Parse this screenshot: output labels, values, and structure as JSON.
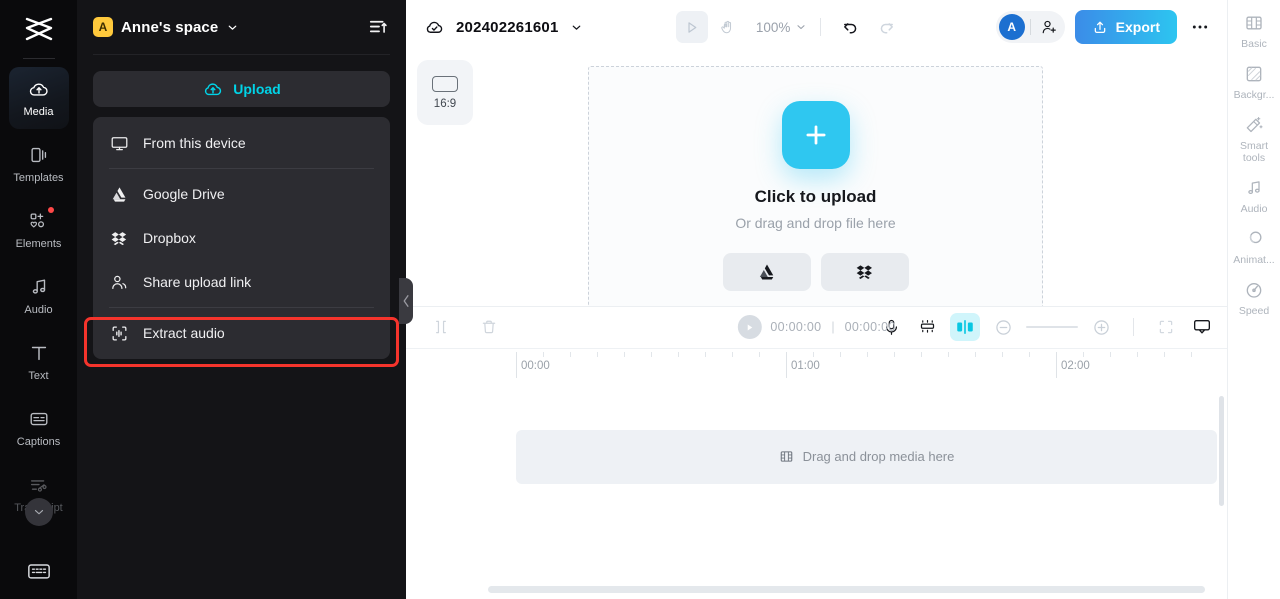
{
  "left_rail": {
    "logo_name": "capcut-logo",
    "items": [
      {
        "label": "Media",
        "icon": "cloud-upload-icon",
        "active": true,
        "dim": false,
        "badge": false
      },
      {
        "label": "Templates",
        "icon": "templates-icon",
        "active": false,
        "dim": false,
        "badge": false
      },
      {
        "label": "Elements",
        "icon": "elements-icon",
        "active": false,
        "dim": false,
        "badge": true
      },
      {
        "label": "Audio",
        "icon": "music-note-icon",
        "active": false,
        "dim": false,
        "badge": false
      },
      {
        "label": "Text",
        "icon": "text-t-icon",
        "active": false,
        "dim": false,
        "badge": false
      },
      {
        "label": "Captions",
        "icon": "captions-icon",
        "active": false,
        "dim": false,
        "badge": false
      },
      {
        "label": "Transcript",
        "icon": "transcript-icon",
        "active": false,
        "dim": true,
        "badge": false
      }
    ],
    "collapse_icon": "chevron-down-icon",
    "bottom_icon": "keyboard-shortcuts-icon"
  },
  "panel": {
    "space_initial": "A",
    "space_name": "Anne's space",
    "space_chevron": "chevron-down-icon",
    "sort_icon": "sort-ascending-icon",
    "upload_label": "Upload",
    "upload_icon": "cloud-upload-icon",
    "menu": [
      {
        "label": "From this device",
        "icon": "monitor-icon",
        "rule_after": true,
        "highlighted": false
      },
      {
        "label": "Google Drive",
        "icon": "google-drive-icon",
        "rule_after": false,
        "highlighted": false
      },
      {
        "label": "Dropbox",
        "icon": "dropbox-icon",
        "rule_after": false,
        "highlighted": false
      },
      {
        "label": "Share upload link",
        "icon": "people-icon",
        "rule_after": true,
        "highlighted": false
      },
      {
        "label": "Extract audio",
        "icon": "extract-audio-icon",
        "rule_after": false,
        "highlighted": true
      }
    ],
    "collapse_handle_icon": "chevron-left-icon"
  },
  "topbar": {
    "cloud_icon": "cloud-saved-icon",
    "project_name": "202402261601",
    "project_chevron": "chevron-down-icon",
    "play_icon": "play-icon",
    "hand_icon": "hand-tool-icon",
    "zoom_level": "100%",
    "zoom_chevron": "chevron-down-icon",
    "undo_icon": "undo-icon",
    "redo_icon": "redo-icon",
    "avatar_initial": "A",
    "avatar_color": "#1c6fd0",
    "add_user_icon": "add-user-icon",
    "export_label": "Export",
    "export_icon": "share-up-icon",
    "more_icon": "more-horizontal-icon"
  },
  "canvas": {
    "ratio_label": "16:9",
    "ratio_icon": "aspect-ratio-icon",
    "plus_icon": "plus-icon",
    "title": "Click to upload",
    "subtitle": "Or drag and drop file here",
    "buttons": [
      {
        "icon": "google-drive-icon",
        "name": "google-drive-upload-button"
      },
      {
        "icon": "dropbox-icon",
        "name": "dropbox-upload-button"
      }
    ]
  },
  "timeline": {
    "split_icon": "split-clip-icon",
    "delete_icon": "delete-icon",
    "play_icon": "play-icon",
    "current_time": "00:00:00",
    "separator": "|",
    "total_time": "00:00:00",
    "mic_icon": "microphone-icon",
    "keyframe_icon": "keyframe-icon",
    "split_view_icon": "split-view-icon",
    "zoom_out_icon": "zoom-out-icon",
    "zoom_in_icon": "zoom-in-icon",
    "fit_icon": "fit-to-screen-icon",
    "preview_icon": "preview-monitor-icon",
    "ruler_labels": [
      "00:00",
      "01:00",
      "02:00"
    ],
    "track_hint": "Drag and drop media here",
    "track_hint_icon": "film-strip-icon"
  },
  "right_rail": {
    "items": [
      {
        "label": "Basic",
        "icon": "basic-icon"
      },
      {
        "label": "Backgr...",
        "icon": "background-icon"
      },
      {
        "label": "Smart tools",
        "icon": "magic-wand-icon"
      },
      {
        "label": "Audio",
        "icon": "music-note-icon"
      },
      {
        "label": "Animat...",
        "icon": "animation-icon"
      },
      {
        "label": "Speed",
        "icon": "speed-icon"
      }
    ]
  },
  "colors": {
    "accent_cyan": "#00d4e8",
    "highlight_red": "#f5342c",
    "export_blue": "#3b8ce8",
    "panel_bg": "#141417",
    "rail_bg": "#0a0a0c"
  }
}
